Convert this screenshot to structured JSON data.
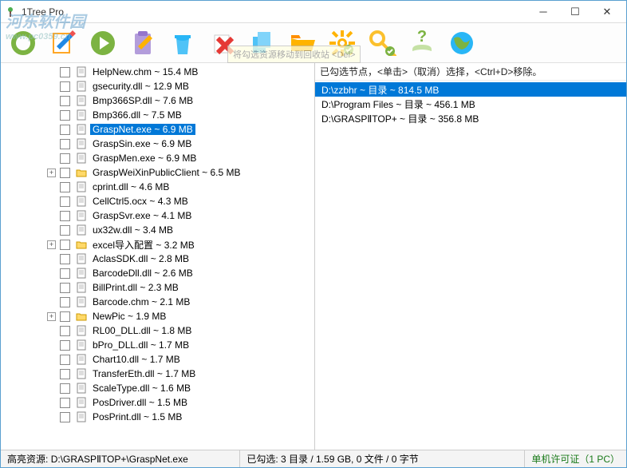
{
  "window": {
    "title": "1Tree Pro"
  },
  "tooltip": "将勾选资源移动到回收站 <Del>",
  "tree_items": [
    {
      "type": "file",
      "name": "HelpNew.chm ~ 15.4 MB",
      "selected": false
    },
    {
      "type": "file",
      "name": "gsecurity.dll ~ 12.9 MB",
      "selected": false
    },
    {
      "type": "file",
      "name": "Bmp366SP.dll ~ 7.6 MB",
      "selected": false
    },
    {
      "type": "file",
      "name": "Bmp366.dll ~ 7.5 MB",
      "selected": false
    },
    {
      "type": "file",
      "name": "GraspNet.exe ~ 6.9 MB",
      "selected": true
    },
    {
      "type": "file",
      "name": "GraspSin.exe ~ 6.9 MB",
      "selected": false
    },
    {
      "type": "file",
      "name": "GraspMen.exe ~ 6.9 MB",
      "selected": false
    },
    {
      "type": "folder",
      "name": "GraspWeiXinPublicClient ~ 6.5 MB",
      "selected": false,
      "expandable": true
    },
    {
      "type": "file",
      "name": "cprint.dll ~ 4.6 MB",
      "selected": false
    },
    {
      "type": "file",
      "name": "CellCtrl5.ocx ~ 4.3 MB",
      "selected": false
    },
    {
      "type": "file",
      "name": "GraspSvr.exe ~ 4.1 MB",
      "selected": false
    },
    {
      "type": "file",
      "name": "ux32w.dll ~ 3.4 MB",
      "selected": false
    },
    {
      "type": "folder",
      "name": "excel导入配置 ~ 3.2 MB",
      "selected": false,
      "expandable": true
    },
    {
      "type": "file",
      "name": "AclasSDK.dll ~ 2.8 MB",
      "selected": false
    },
    {
      "type": "file",
      "name": "BarcodeDll.dll ~ 2.6 MB",
      "selected": false
    },
    {
      "type": "file",
      "name": "BillPrint.dll ~ 2.3 MB",
      "selected": false
    },
    {
      "type": "file",
      "name": "Barcode.chm ~ 2.1 MB",
      "selected": false
    },
    {
      "type": "folder",
      "name": "NewPic ~ 1.9 MB",
      "selected": false,
      "expandable": true
    },
    {
      "type": "file",
      "name": "RL00_DLL.dll ~ 1.8 MB",
      "selected": false
    },
    {
      "type": "file",
      "name": "bPro_DLL.dll ~ 1.7 MB",
      "selected": false
    },
    {
      "type": "file",
      "name": "Chart10.dll ~ 1.7 MB",
      "selected": false
    },
    {
      "type": "file",
      "name": "TransferEth.dll ~ 1.7 MB",
      "selected": false
    },
    {
      "type": "file",
      "name": "ScaleType.dll ~ 1.6 MB",
      "selected": false
    },
    {
      "type": "file",
      "name": "PosDriver.dll ~ 1.5 MB",
      "selected": false
    },
    {
      "type": "file",
      "name": "PosPrint.dll ~ 1.5 MB",
      "selected": false
    }
  ],
  "right_header": "已勾选节点，<单击>（取消）选择，<Ctrl+D>移除。",
  "right_items": [
    {
      "text": "D:\\zzbhr ~ 目录 ~ 814.5 MB",
      "selected": true
    },
    {
      "text": "D:\\Program Files ~ 目录 ~ 456.1 MB",
      "selected": false
    },
    {
      "text": "D:\\GRASPⅡTOP+ ~ 目录 ~ 356.8 MB",
      "selected": false
    }
  ],
  "status": {
    "left_label": "高亮资源:",
    "left_path": "D:\\GRASPⅡTOP+\\GraspNet.exe",
    "mid": "已勾选:  3 目录 / 1.59 GB, 0 文件 / 0 字节",
    "right": "单机许可证（1 PC）"
  },
  "watermark": {
    "top": "河东软件园",
    "bottom": "www.pc0359.cn"
  },
  "toolbar_icons": [
    "refresh-icon",
    "edit-icon",
    "play-icon",
    "clipboard-edit-icon",
    "trash-icon",
    "delete-icon",
    "copy-icon",
    "folder-open-icon",
    "gear-icon",
    "key-icon",
    "help-icon",
    "globe-icon"
  ]
}
